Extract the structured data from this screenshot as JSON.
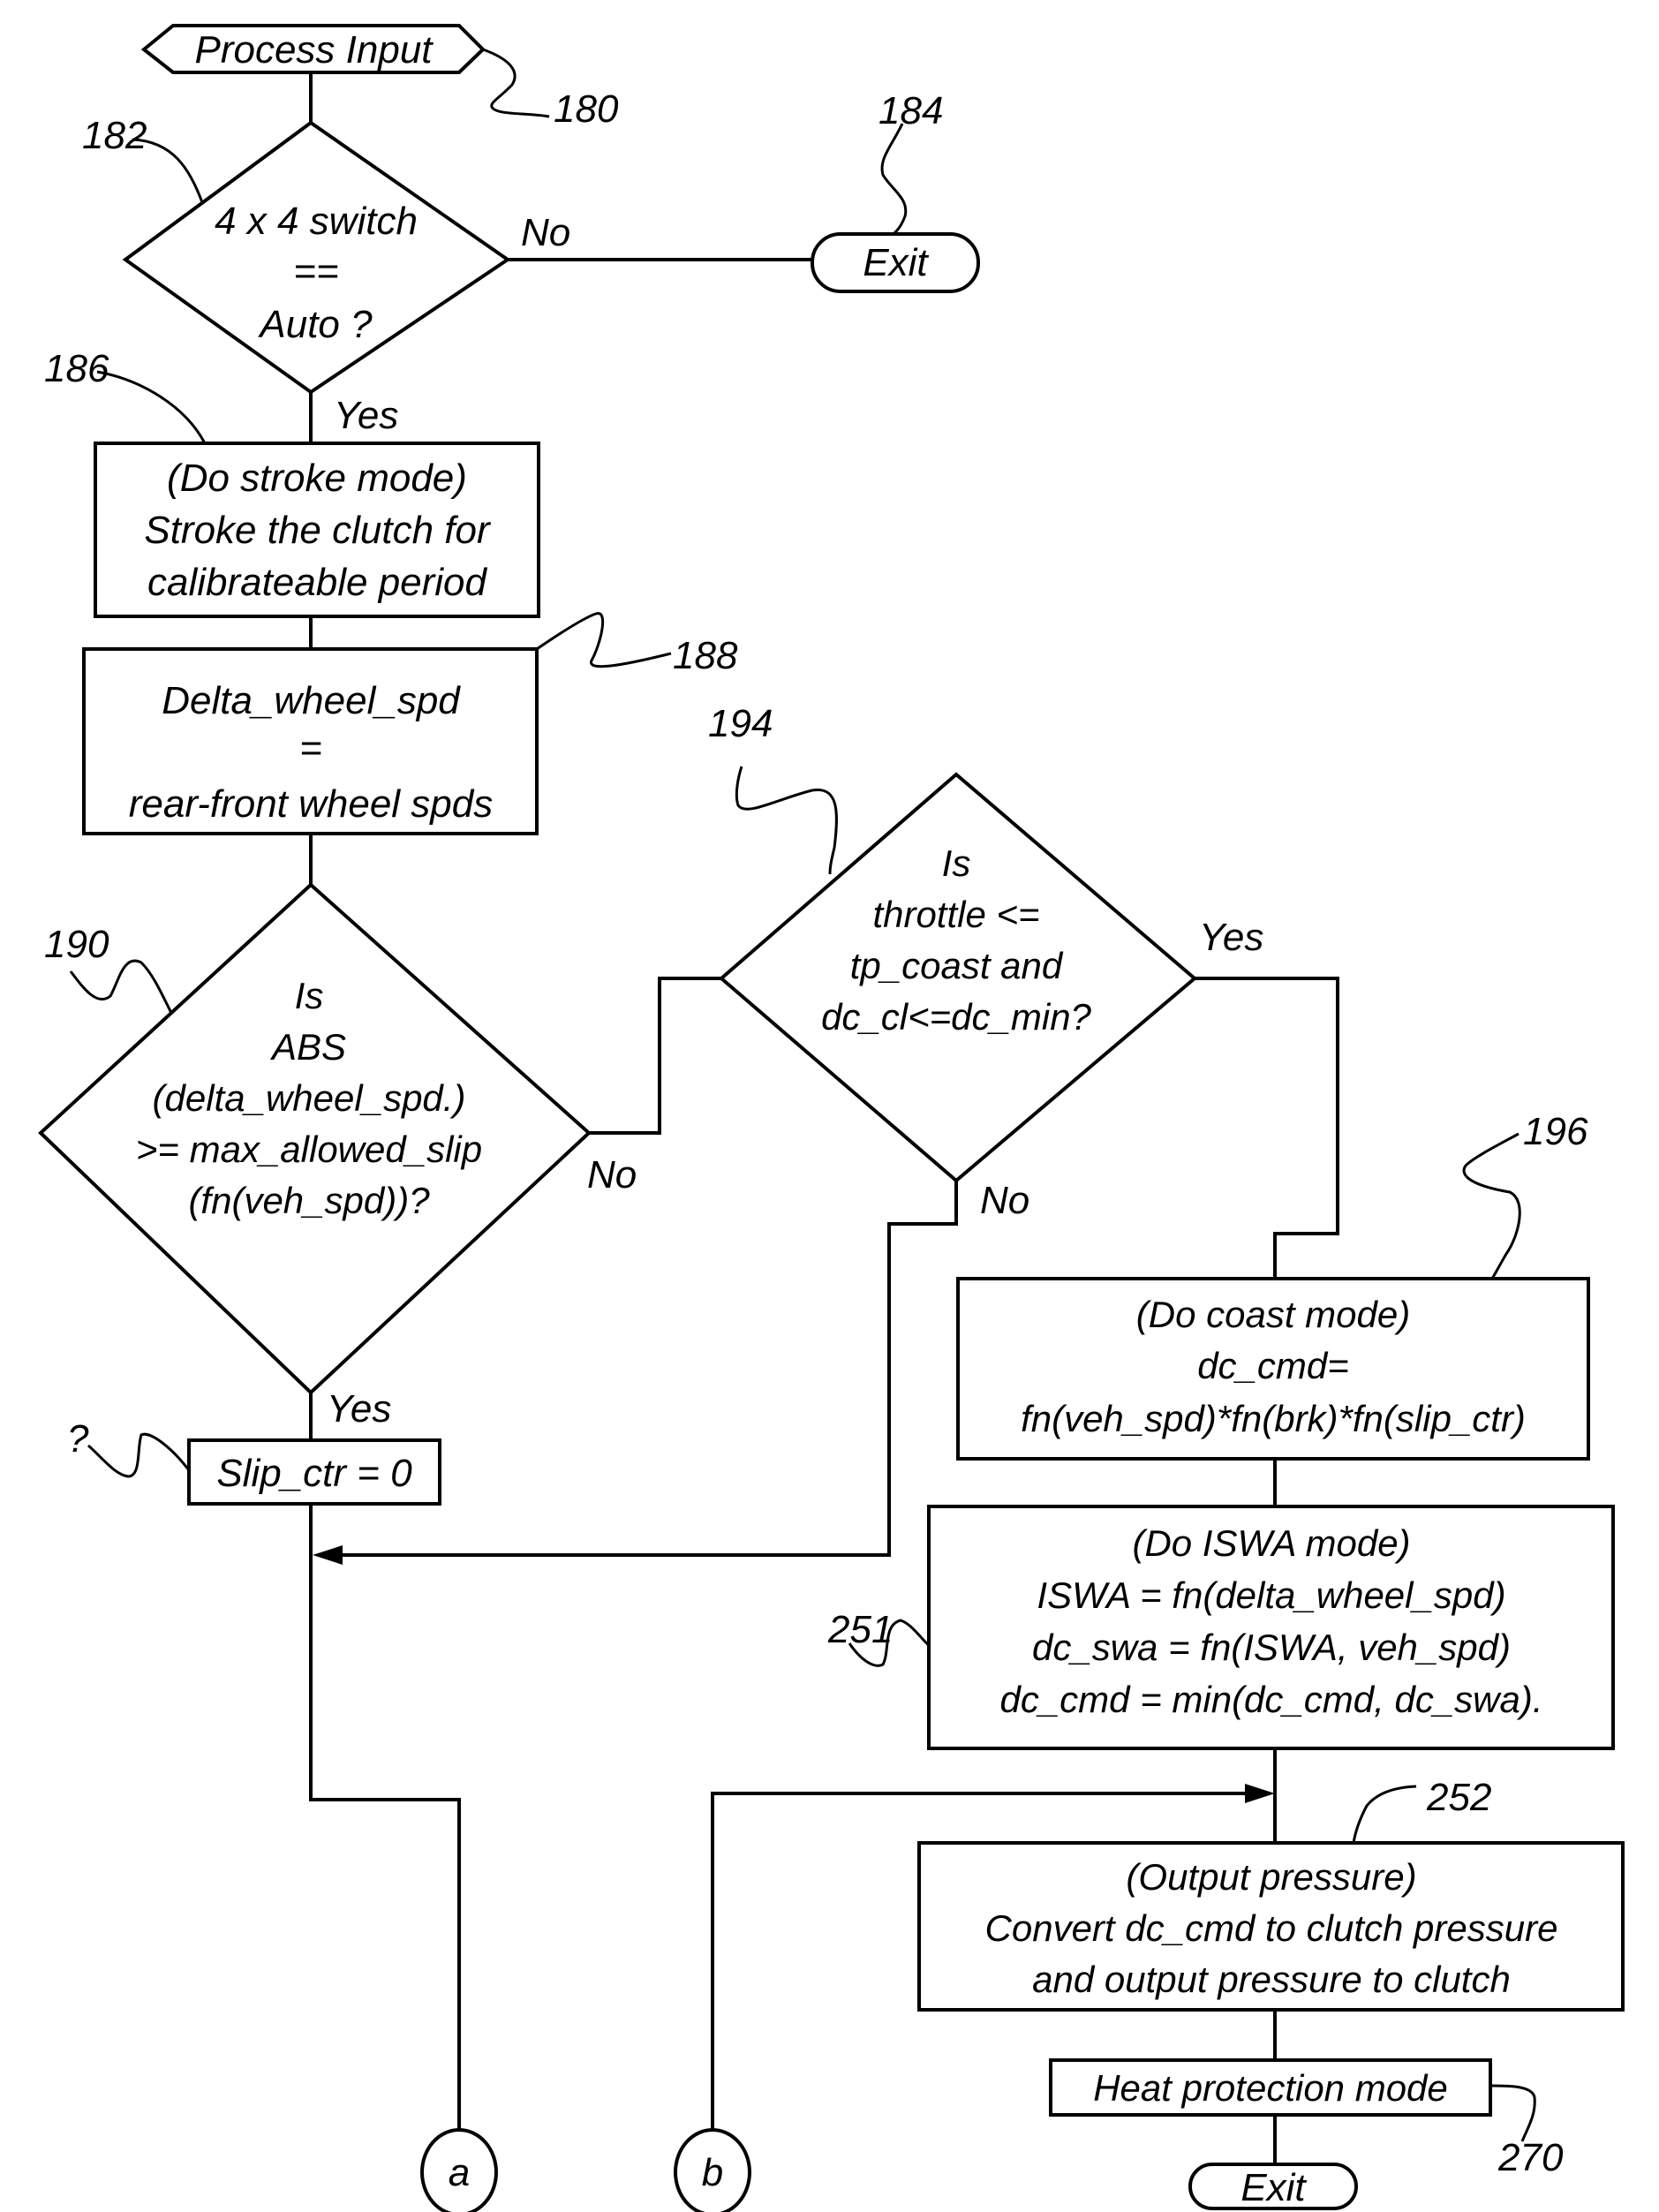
{
  "colors": {
    "ink": "#000000",
    "background": "#ffffff"
  },
  "nodes": {
    "process_input": {
      "ref": "180",
      "label": "Process Input"
    },
    "switch_check": {
      "ref": "182",
      "lines": [
        "4 x 4 switch",
        "==",
        "Auto ?"
      ],
      "no_label": "No",
      "yes_label": "Yes"
    },
    "exit_top": {
      "ref": "184",
      "label": "Exit"
    },
    "stroke_mode": {
      "ref": "186",
      "lines": [
        "(Do stroke mode)",
        "Stroke the clutch for",
        "calibrateable period"
      ]
    },
    "delta_wheel": {
      "ref": "188",
      "lines": [
        "Delta_wheel_spd",
        "=",
        "rear-front wheel spds"
      ]
    },
    "abs_check": {
      "ref": "190",
      "lines": [
        "Is",
        "ABS",
        "(delta_wheel_spd.)",
        ">= max_allowed_slip",
        "(fn(veh_spd))?"
      ],
      "no_label": "No",
      "yes_label": "Yes"
    },
    "throttle_check": {
      "ref": "194",
      "lines": [
        "Is",
        "throttle <=",
        "tp_coast and",
        "dc_cl<=dc_min?"
      ],
      "yes_label": "Yes",
      "no_label": "No"
    },
    "slip_reset": {
      "ref": "?",
      "label": "Slip_ctr = 0"
    },
    "coast_mode": {
      "ref": "196",
      "lines": [
        "(Do coast mode)",
        "dc_cmd=",
        "fn(veh_spd)*fn(brk)*fn(slip_ctr)"
      ]
    },
    "iswa_mode": {
      "ref": "251",
      "lines": [
        "(Do ISWA mode)",
        "ISWA = fn(delta_wheel_spd)",
        "dc_swa = fn(ISWA, veh_spd)",
        "dc_cmd = min(dc_cmd, dc_swa)."
      ]
    },
    "output_pressure": {
      "ref": "252",
      "lines": [
        "(Output pressure)",
        "Convert dc_cmd to clutch pressure",
        "and output pressure to clutch"
      ]
    },
    "heat_protection": {
      "ref": "270",
      "label": "Heat protection mode"
    },
    "exit_bottom": {
      "label": "Exit"
    },
    "connector_a": {
      "label": "a"
    },
    "connector_b": {
      "label": "b"
    }
  }
}
